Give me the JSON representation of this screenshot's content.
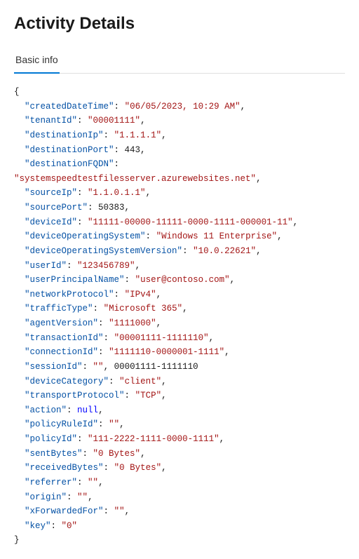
{
  "header": {
    "title": "Activity Details"
  },
  "tabs": [
    {
      "label": "Basic info",
      "active": true
    }
  ],
  "json_content": {
    "createdDateTime": "06/05/2023, 10:29 AM",
    "tenantId": "00001111",
    "destinationIp": "1.1.1.1",
    "destinationPort": "443",
    "destinationFQDN": "systemspeedtestfilesserver.azurewebsites.net",
    "sourceIp": "1.1.0.1.1",
    "sourcePort": "50383",
    "deviceId": "11111-00000-11111-0000-1111-000001-11",
    "deviceOperatingSystem": "Windows 11 Enterprise",
    "deviceOperatingSystemVersion": "10.0.22621",
    "userId": "123456789",
    "userPrincipalName": "user@contoso.com",
    "networkProtocol": "IPv4",
    "trafficType": "Microsoft 365",
    "agentVersion": "1111000",
    "transactionId": "00001111-1111110",
    "connectionId": "1111110-0000001-1111",
    "sessionId": "00001111-1111110",
    "deviceCategory": "client",
    "transportProtocol": "TCP",
    "action": null,
    "policyRuleId": "",
    "policyId": "111-2222-1111-0000-1111",
    "sentBytes": "0 Bytes",
    "receivedBytes": "0 Bytes",
    "referrer": "",
    "origin": "",
    "xForwardedFor": "",
    "key": "0"
  }
}
